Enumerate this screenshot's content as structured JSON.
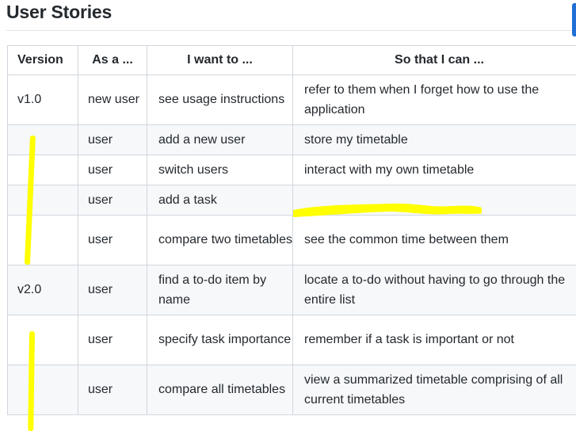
{
  "page": {
    "heading": "User Stories"
  },
  "table": {
    "headers": [
      "Version",
      "As a ...",
      "I want to ...",
      "So that I can ..."
    ],
    "rows": [
      {
        "version": "v1.0",
        "as_a": "new user",
        "want": "see usage instructions",
        "so_that": "refer to them when I forget how to use the application"
      },
      {
        "version": "",
        "as_a": "user",
        "want": "add a new user",
        "so_that": "store my timetable"
      },
      {
        "version": "",
        "as_a": "user",
        "want": "switch users",
        "so_that": "interact with my own timetable"
      },
      {
        "version": "",
        "as_a": "user",
        "want": "add a task",
        "so_that": ""
      },
      {
        "version": "",
        "as_a": "user",
        "want": "compare two timetables",
        "so_that": "see the common time between them"
      },
      {
        "version": "v2.0",
        "as_a": "user",
        "want": "find a to-do item by name",
        "so_that": "locate a to-do without having to go through the entire list"
      },
      {
        "version": "",
        "as_a": "user",
        "want": "specify task importance",
        "so_that": "remember if a task is important or not"
      },
      {
        "version": "",
        "as_a": "user",
        "want": "compare all timetables",
        "so_that": "view a summarized timetable comprising of all current timetables"
      }
    ]
  },
  "annotations": {
    "highlight_color": "#ffff00"
  }
}
